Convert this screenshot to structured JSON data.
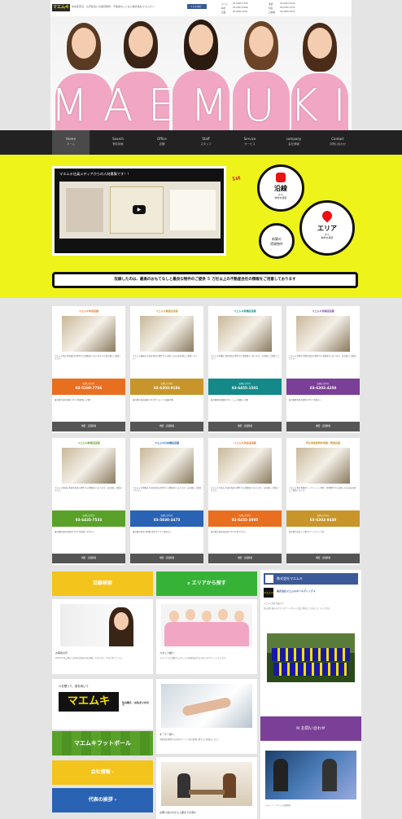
{
  "header": {
    "logo": "マエムキ",
    "tagline": "中央区周辺・山手線沿いの賃貸物件、不動産のことなら株式会社マエムキへ",
    "facebook": "f いいね！",
    "phones": [
      {
        "label": "ホーム",
        "number": "03-5289-7756"
      },
      {
        "label": "本社",
        "number": "03-6303-9186"
      },
      {
        "label": "店舗",
        "number": "03-6455-1501"
      },
      {
        "label": "池袋",
        "number": "03-6303-4350"
      },
      {
        "label": "新宿",
        "number": "03-6435-7533"
      },
      {
        "label": "日本橋",
        "number": "03-5830-3475"
      }
    ]
  },
  "hero": {
    "brand": "MAEMUKI"
  },
  "nav": {
    "items": [
      {
        "en": "Home",
        "ja": "ホーム"
      },
      {
        "en": "Search",
        "ja": "物件検索"
      },
      {
        "en": "Office",
        "ja": "店舗"
      },
      {
        "en": "Staff",
        "ja": "スタッフ"
      },
      {
        "en": "Service",
        "ja": "サービス"
      },
      {
        "en": "company",
        "ja": "会社情報"
      },
      {
        "en": "Contact",
        "ja": "お問い合わせ"
      }
    ]
  },
  "feature": {
    "video_title": "マエムキ社員メディアからの人材募集です！！",
    "badge": "1st",
    "line_search": {
      "big": "沿線",
      "small1": "から",
      "small2": "物件を検索"
    },
    "area_search": {
      "big": "エリア",
      "small1": "から",
      "small2": "物件を検索"
    },
    "buyer_search": {
      "line1": "新築の",
      "line2": "賃貸物件"
    },
    "notice": "収録したのは、最高のおもてなしと最良な物件のご提供 ５ 万社以上の不動産会社の情報をご用意しております"
  },
  "offices": [
    {
      "name": "マエムキ本店店舗",
      "desc": "マエムキ本店 新宿周辺の物件から多数揃えておりますのでお気軽にご相談ください。",
      "tel_label": "お問い合わせ",
      "tel": "03-5289-7756",
      "addr": "東京都中央区新富1-11-1 新富MJビル3階",
      "btn": "地図・店舗情報",
      "color": "#e86f1f"
    },
    {
      "name": "マエムキ銀座店店舗",
      "desc": "マエムキ銀座店 中央区周辺の物件からお探しの方はお気軽にご相談ください。",
      "tel_label": "お問い合わせ",
      "tel": "03-6303-9186",
      "addr": "東京都中央区銀座1-20-18 マテリアル銀座3階",
      "btn": "地図・店舗情報",
      "color": "#c8952a"
    },
    {
      "name": "マエムキ新橋店店舗",
      "desc": "マエムキ新橋店 港区周辺の物件から多数揃えております。お気軽にご相談ください。",
      "tel_label": "お問い合わせ",
      "tel": "03-6455-1501",
      "addr": "東京都港区新橋2-16-1 ニュー新橋ビル2階",
      "btn": "地図・店舗情報",
      "color": "#13898a"
    },
    {
      "name": "マエムキ池袋店店舗",
      "desc": "マエムキ池袋店 豊島区周辺の物件から多数揃えております。お気軽にご相談ください。",
      "tel_label": "お問い合わせ",
      "tel": "03-6303-4350",
      "addr": "東京都豊島区南池袋1-25-1 池袋ビル",
      "btn": "地図・店舗情報",
      "color": "#7a3f96"
    },
    {
      "name": "マエムキ新宿店店舗",
      "desc": "マエムキ新宿店 新宿区周辺の物件から多数揃えております。お気軽にご相談ください。",
      "tel_label": "お問い合わせ",
      "tel": "03-6435-7533",
      "addr": "東京都新宿区西新宿1-19-4 新宿第一生命ビル",
      "btn": "地図・店舗情報",
      "color": "#5aa12a"
    },
    {
      "name": "マエムキ日本橋店店舗",
      "desc": "マエムキ日本橋店 中央区周辺の物件から多数揃えております。お気軽にご相談ください。",
      "tel_label": "お問い合わせ",
      "tel": "03-5830-3475",
      "addr": "東京都中央区日本橋人形町1-7-3 人形町ビル",
      "btn": "地図・店舗情報",
      "color": "#2a63b4"
    },
    {
      "name": "マエムキ渋谷店店舗",
      "desc": "マエムキ渋谷店 渋谷区周辺の物件から多数揃えております。お気軽にご相談ください。",
      "tel_label": "お問い合わせ",
      "tel": "03-6455-3905",
      "addr": "東京都渋谷区道玄坂2-10-12 新大宗ビル",
      "btn": "地図・店舗情報",
      "color": "#e86f1f"
    },
    {
      "name": "再生事業部物件情報・管理店舗",
      "desc": "マエムキ再生事業部 リノベーション物件、管理物件からお探しの方はお気軽にご相談ください。",
      "tel_label": "お問い合わせ",
      "tel": "03-6303-9449",
      "addr": "東京都中央区八丁堀3-1-7 アクア八丁堀",
      "btn": "地図・店舗情報",
      "color": "#c8952a"
    }
  ],
  "lower": {
    "line_search_btn": "沿線検索",
    "area_search_btn": "エリアから探す",
    "recruit_title": "お客様の声",
    "recruit_text": "2016年1月以降の入居者の皆様の声を掲載しております。ぜひご覧ください。",
    "staff_title": "スタッフ紹介",
    "staff_text": "メディアでも活躍するスタッフがお客様の住まい探しをサポートいたします。",
    "banner_catch": "人を想って、前を向いて",
    "banner_logo": "マエムキ",
    "banner_sub": "住み替え・お住まいの方へ",
    "cheer_title": "マエムキフットボール",
    "owner_title": "オーナー様へ",
    "owner_text": "不動産投資物件の売却やオーナー様の管理に関するご相談はこちら。",
    "company_btn": "会社情報",
    "president_btn": "代表の挨拶",
    "consult_title": "お問い合わせから入居までの流れ"
  },
  "sidebar": {
    "fb_title": "株式会社マエムキ",
    "fb_company": "株式会社マエムキホールディングス",
    "fb_text1": "マエムキ代表 前田です",
    "fb_text2": "先日は社員みんなでバスケットボール大会に参加してきました！もっと見る",
    "contact_btn": "お問い合わせ",
    "media_caption": "メディア・イベント出演情報"
  },
  "colors": {
    "yellow": "#eef31a",
    "nav": "#222222",
    "line_btn": "#f2c41c",
    "area_btn": "#36b336",
    "contact_btn": "#7a3f96",
    "company_btn": "#f2c41c",
    "president_btn": "#2a63b4"
  }
}
